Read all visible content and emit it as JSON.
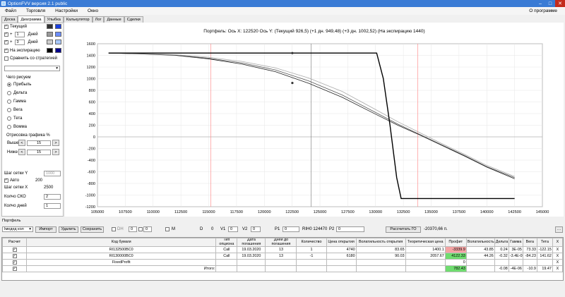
{
  "window": {
    "title": "OptionFVV версия 2.1 public"
  },
  "menu": {
    "file": "Файл",
    "trade": "Торговля",
    "settings": "Настройки",
    "window": "Окно",
    "about": "О программе"
  },
  "tabs": [
    "Доска",
    "Диаграмма",
    "Улыбка",
    "Калькулятор",
    "Лог",
    "Данные",
    "Сделки"
  ],
  "left": {
    "current": "Текущий",
    "plus": "+",
    "days1": "1",
    "days": "Дней",
    "days3": "3",
    "expiration": "На экспирацию",
    "compare": "Сравнить со стратегией",
    "draw_title": "Чего рисуем",
    "draw_options": [
      "Прибыль",
      "Дельта",
      "Гамма",
      "Вега",
      "Тета",
      "Вомма"
    ],
    "margin_title": "Отрисовка графика %",
    "above": "Выше",
    "below": "Ниже",
    "above_val": "15",
    "below_val": "15",
    "step_y": "Шаг сетки Y",
    "step_y_val": "1000",
    "auto": "Авто",
    "auto_val": "200",
    "step_x": "Шаг сетки X",
    "step_x_val": "2500",
    "sko": "Колчо СКО",
    "sko_val": "2",
    "days_count": "Колчо дней",
    "days_count_val": "1",
    "lt": "<",
    "gt": ">"
  },
  "chart_data": {
    "type": "line",
    "title": "Портфель:  Ось X:  122520 Ось Y:  (Текущий 926,5)  (+1 дн. 949,48)  (+3 дн. 1002,52)  (На экспирацию 1440)",
    "xlim": [
      105000,
      145000
    ],
    "ylim": [
      -1200,
      1600
    ],
    "x_ticks": [
      "105000",
      "107500",
      "110000",
      "112500",
      "115000",
      "117500",
      "120000",
      "122500",
      "125000",
      "127500",
      "130000",
      "132500",
      "135000",
      "137500",
      "140000",
      "142500",
      "145000"
    ],
    "y_ticks": [
      "1600",
      "1400",
      "1200",
      "1000",
      "800",
      "600",
      "400",
      "200",
      "0",
      "-200",
      "-400",
      "-600",
      "-800",
      "-1000",
      "-1200"
    ],
    "series": [
      {
        "color": "#222222",
        "x": [
          106000,
          109000,
          112000,
          115000,
          118000,
          121000,
          124000,
          127000,
          130000,
          132000,
          134000,
          136000,
          138000,
          140000,
          142500
        ],
        "y": [
          1440,
          1425,
          1400,
          1340,
          1250,
          1120,
          920,
          680,
          390,
          200,
          30,
          -150,
          -330,
          -520,
          -720
        ]
      },
      {
        "color": "#555555",
        "x": [
          106000,
          109000,
          112000,
          115000,
          118000,
          121000,
          124000,
          127000,
          130000,
          132000,
          134000,
          136000,
          138000,
          140000,
          142500
        ],
        "y": [
          1440,
          1428,
          1405,
          1352,
          1270,
          1150,
          960,
          720,
          420,
          220,
          40,
          -140,
          -320,
          -510,
          -700
        ]
      },
      {
        "color": "#aaaaaa",
        "x": [
          106000,
          109000,
          112000,
          115000,
          118000,
          121000,
          124000,
          127000,
          130000,
          132000,
          134000,
          136000,
          138000,
          140000,
          142500
        ],
        "y": [
          1440,
          1432,
          1412,
          1368,
          1295,
          1185,
          1010,
          780,
          470,
          260,
          70,
          -120,
          -300,
          -490,
          -680
        ]
      },
      {
        "color": "#000000",
        "x": [
          106000,
          119000,
          130100,
          130700,
          131300,
          131900,
          132300,
          142500
        ],
        "y": [
          1440,
          1440,
          1440,
          1000,
          200,
          -700,
          -1060,
          -1060
        ]
      }
    ],
    "markers": [
      {
        "x": 122520,
        "y": 1440
      },
      {
        "x": 122520,
        "y": 926.5
      }
    ],
    "vlines_red": [
      115200,
      133800
    ],
    "vline_cursor": 124200
  },
  "portfolio": {
    "label": "Портфель",
    "mode": "Імедед кол",
    "import": "Импорт",
    "delete": "Удалить",
    "save": "Сохранить",
    "dh": "DH",
    "zero": "0",
    "m": "M",
    "d": "D",
    "d_val": "0",
    "v1": "V1",
    "v1_val": "0",
    "v2": "V2",
    "v2_val": "0",
    "p1": "P1",
    "p1_val": "0",
    "rih": "RIH0 124470",
    "p2": "P2",
    "p2_val": "0",
    "calc": "Рассчитать ГО",
    "go_val": "-20370,66 п."
  },
  "table": {
    "headers": [
      "Расчет",
      "Код бумаги",
      "Тип опциона",
      "Дата погашения",
      "Дней до погашения",
      "Количество",
      "Цена открытия",
      "Волатильность открытия",
      "Теоретическая цена",
      "Профит",
      "Волатильность",
      "Дельта",
      "Гамма",
      "Вега",
      "Тета",
      "X"
    ],
    "rows": [
      {
        "code": "RI132500BC0",
        "type": "Call",
        "date": "19.03.2020",
        "days": "13",
        "qty": "1",
        "price": "4740",
        "vol_open": "83.65",
        "theor": "1400.1",
        "profit": "-3339.9",
        "vol": "43.85",
        "delta": "0.24",
        "gamma": "3E-05",
        "vega": "73.33",
        "theta": "-122.15",
        "x": "X",
        "pcls": "neg"
      },
      {
        "code": "RI130000BC0",
        "type": "Call",
        "date": "19.03.2020",
        "days": "13",
        "qty": "-1",
        "price": "6180",
        "vol_open": "90.03",
        "theor": "2057.67",
        "profit": "4122.33",
        "vol": "44.26",
        "delta": "-0.32",
        "gamma": "-3.4E-05",
        "vega": "-84.23",
        "theta": "141.62",
        "x": "X",
        "pcls": "pos"
      },
      {
        "code": "FixedProfit",
        "type": "",
        "date": "",
        "days": "",
        "qty": "",
        "price": "",
        "vol_open": "",
        "theor": "",
        "profit": "0",
        "vol": "",
        "delta": "",
        "gamma": "",
        "vega": "",
        "theta": "",
        "x": "X",
        "pcls": ""
      },
      {
        "code": "Итого:",
        "type": "",
        "date": "",
        "days": "",
        "qty": "",
        "price": "",
        "vol_open": "",
        "theor": "",
        "profit": "782.43",
        "vol": "",
        "delta": "-0.08",
        "gamma": "-4E-06",
        "vega": "-10.9",
        "theta": "19.47",
        "x": "X",
        "pcls": "pos"
      }
    ]
  }
}
